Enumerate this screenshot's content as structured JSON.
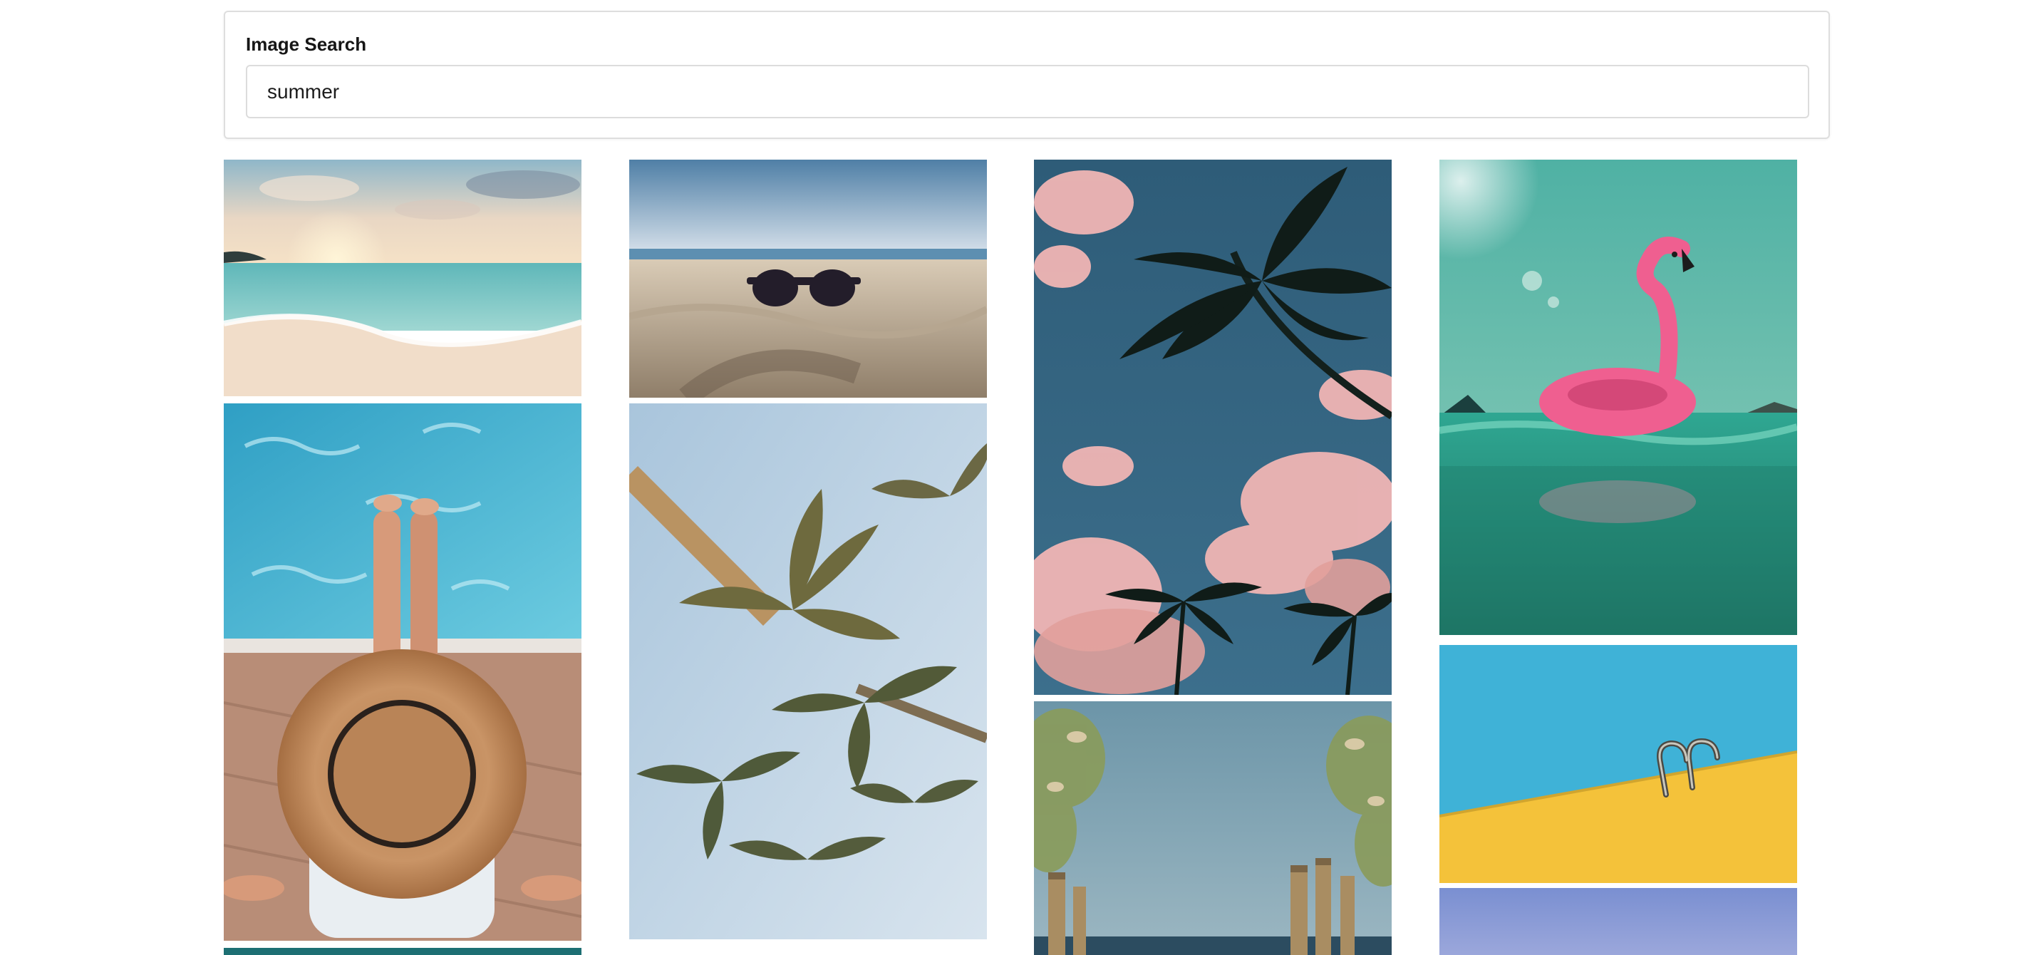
{
  "search": {
    "label": "Image Search",
    "value": "summer"
  },
  "results": [
    {
      "id": "beach-sunset",
      "subject": "beach-sunset-photo"
    },
    {
      "id": "sunglasses-sand",
      "subject": "sunglasses-on-sand-photo"
    },
    {
      "id": "palm-sky-pink",
      "subject": "palm-trees-pink-clouds-photo"
    },
    {
      "id": "flamingo-float",
      "subject": "flamingo-float-photo"
    },
    {
      "id": "pool-hat",
      "subject": "straw-hat-pool-photo"
    },
    {
      "id": "palms-looking-up",
      "subject": "palm-trees-from-below-photo"
    },
    {
      "id": "boardwalk-sea",
      "subject": "boardwalk-to-sea-photo"
    },
    {
      "id": "pool-ladder",
      "subject": "pool-ladder-photo"
    },
    {
      "id": "teal-partial",
      "subject": "teal-water-photo"
    },
    {
      "id": "blue-partial",
      "subject": "blue-sky-photo"
    }
  ]
}
